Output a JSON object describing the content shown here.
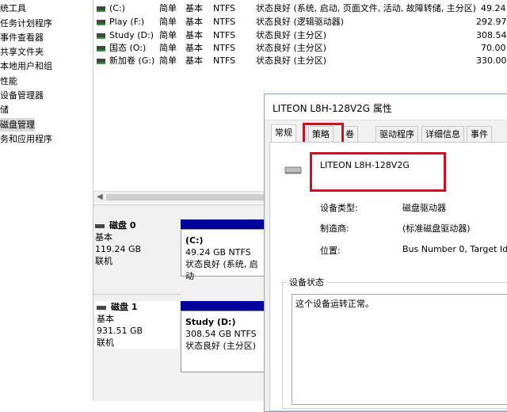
{
  "left_tree": {
    "items": [
      {
        "label": "统工具",
        "selected": false
      },
      {
        "label": "任务计划程序",
        "selected": false
      },
      {
        "label": "事件查看器",
        "selected": false
      },
      {
        "label": "共享文件夹",
        "selected": false
      },
      {
        "label": "本地用户和组",
        "selected": false
      },
      {
        "label": "性能",
        "selected": false
      },
      {
        "label": "设备管理器",
        "selected": false
      },
      {
        "label": "储",
        "selected": false
      },
      {
        "label": "磁盘管理",
        "selected": true
      },
      {
        "label": "务和应用程序",
        "selected": false
      }
    ]
  },
  "volume_list": {
    "rows": [
      {
        "name": "(C:)",
        "layout": "简单",
        "type": "基本",
        "fs": "NTFS",
        "status": "状态良好 (系统, 启动, 页面文件, 活动, 故障转储, 主分区)",
        "capacity": "49.24"
      },
      {
        "name": "Play (F:)",
        "layout": "简单",
        "type": "基本",
        "fs": "NTFS",
        "status": "状态良好 (逻辑驱动器)",
        "capacity": "292.97"
      },
      {
        "name": "Study (D:)",
        "layout": "简单",
        "type": "基本",
        "fs": "NTFS",
        "status": "状态良好 (主分区)",
        "capacity": "308.54"
      },
      {
        "name": "国态 (O:)",
        "layout": "简单",
        "type": "基本",
        "fs": "NTFS",
        "status": "状态良好 (主分区)",
        "capacity": "70.00"
      },
      {
        "name": "新加卷 (G:)",
        "layout": "简单",
        "type": "基本",
        "fs": "NTFS",
        "status": "状态良好 (主分区)",
        "capacity": "330.00"
      }
    ]
  },
  "disk_map": {
    "disks": [
      {
        "name": "磁盘 0",
        "type": "基本",
        "size": "119.24 GB",
        "state": "联机",
        "partition": {
          "name": "(C:)",
          "size": "49.24 GB NTFS",
          "status": "状态良好 (系统, 启动"
        }
      },
      {
        "name": "磁盘 1",
        "type": "基本",
        "size": "931.51 GB",
        "state": "联机",
        "partition": {
          "name": "Study  (D:)",
          "size": "308.54 GB NTFS",
          "status": "状态良好 (主分区)"
        }
      }
    ]
  },
  "dialog": {
    "title": "LITEON L8H-128V2G 属性",
    "tabs": [
      "常规",
      "策略",
      "卷",
      "驱动程序",
      "详细信息",
      "事件"
    ],
    "active_tab": "常规",
    "device_name": "LITEON L8H-128V2G",
    "props": [
      {
        "label": "设备类型:",
        "value": "磁盘驱动器"
      },
      {
        "label": "制造商:",
        "value": "(标准磁盘驱动器)"
      },
      {
        "label": "位置:",
        "value": "Bus Number 0, Target Id"
      }
    ],
    "status_group_label": "设备状态",
    "status_text": "这个设备运转正常。"
  },
  "colors": {
    "highlight_red": "#d01020",
    "partition_bar": "#00009c",
    "selected_row": "#d9d9d9"
  }
}
